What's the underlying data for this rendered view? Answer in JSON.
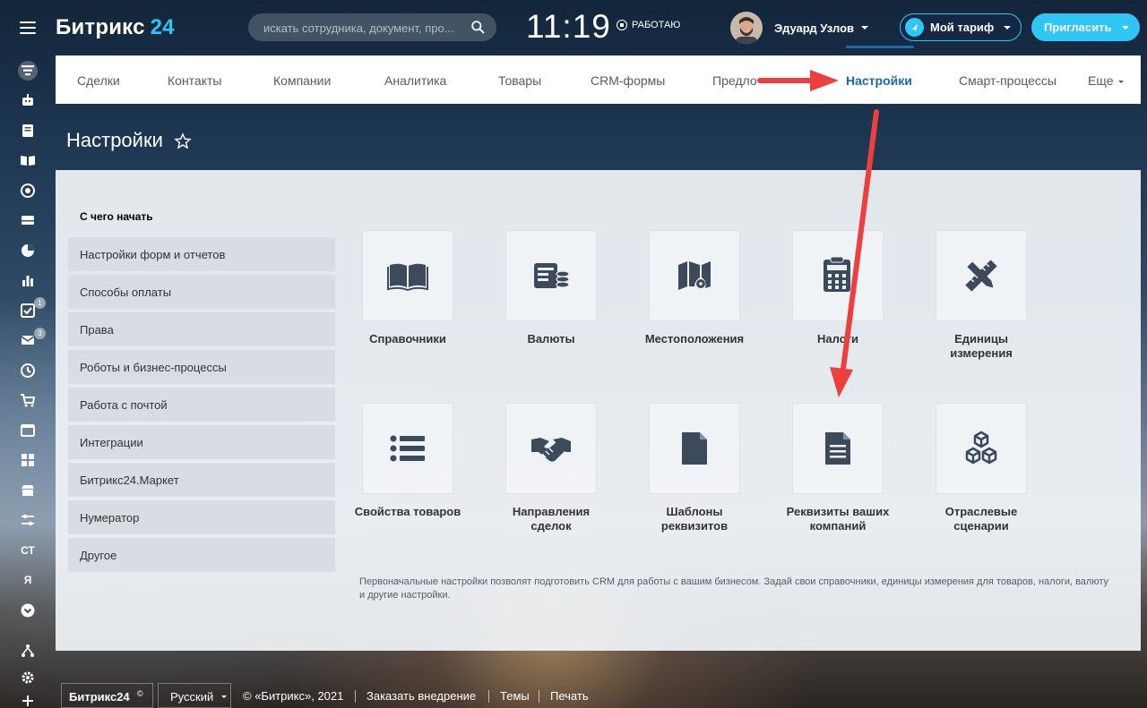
{
  "header": {
    "logo_text": "Битрикс",
    "logo_num": "24",
    "search_placeholder": "искать сотрудника, документ, про...",
    "time": "11:19",
    "work_status": "РАБОТАЮ",
    "user_name": "Эдуард Узлов",
    "tariff_label": "Мой тариф",
    "invite_label": "Пригласить"
  },
  "rail": {
    "icons": [
      "funnel-icon",
      "robot-icon",
      "document-icon",
      "book-icon",
      "target-icon",
      "inbox-icon",
      "pie-chart-icon",
      "bar-chart-icon",
      "tasks-icon",
      "mail-icon",
      "clock-icon",
      "cart-icon",
      "window-icon",
      "grid-icon",
      "store-icon",
      "settings-sliders-icon",
      "arrow-down-circle-icon",
      "sitemap-icon",
      "gear-icon",
      "plus-icon"
    ],
    "badges": {
      "tasks": "1",
      "mail": "3"
    },
    "text_items": [
      "СТ",
      "Я"
    ]
  },
  "tabs": {
    "items": [
      "Сделки",
      "Контакты",
      "Компании",
      "Аналитика",
      "Товары",
      "CRM-формы",
      "Предло",
      "Настройки",
      "Смарт-процессы",
      "Еще"
    ],
    "active": "Настройки"
  },
  "page": {
    "title": "Настройки"
  },
  "menu": {
    "heading": "С чего начать",
    "items": [
      "Настройки форм и отчетов",
      "Способы оплаты",
      "Права",
      "Роботы и бизнес-процессы",
      "Работа с почтой",
      "Интеграции",
      "Битрикс24.Маркет",
      "Нумератор",
      "Другое"
    ]
  },
  "tiles": [
    {
      "icon": "book-icon",
      "line1": "Справочники",
      "line2": ""
    },
    {
      "icon": "currency-icon",
      "line1": "Валюты",
      "line2": ""
    },
    {
      "icon": "map-pin-icon",
      "line1": "Местоположения",
      "line2": ""
    },
    {
      "icon": "calculator-icon",
      "line1": "Налоги",
      "line2": ""
    },
    {
      "icon": "ruler-pencil-icon",
      "line1": "Единицы",
      "line2": "измерения"
    },
    {
      "icon": "list-icon",
      "line1": "Свойства товаров",
      "line2": ""
    },
    {
      "icon": "handshake-icon",
      "line1": "Направления",
      "line2": "сделок"
    },
    {
      "icon": "file-icon",
      "line1": "Шаблоны",
      "line2": "реквизитов"
    },
    {
      "icon": "file-text-icon",
      "line1": "Реквизиты ваших",
      "line2": "компаний"
    },
    {
      "icon": "cubes-icon",
      "line1": "Отраслевые",
      "line2": "сценарии"
    }
  ],
  "description": "Первоначальные настройки позволят подготовить CRM для работы с вашим бизнесом. Задай свои справочники, единицы измерения для товаров, налоги, валюту и другие настройки.",
  "footer": {
    "brand": "Битрикс24",
    "language": "Русский",
    "copyright": "© «Битрикс», 2021",
    "order": "Заказать внедрение",
    "themes": "Темы",
    "print": "Печать"
  },
  "colors": {
    "accent": "#2fc6f6",
    "active_tab": "#2067b0",
    "annotation_arrow": "#ee3f3f",
    "icon": "#3d4a5c"
  }
}
